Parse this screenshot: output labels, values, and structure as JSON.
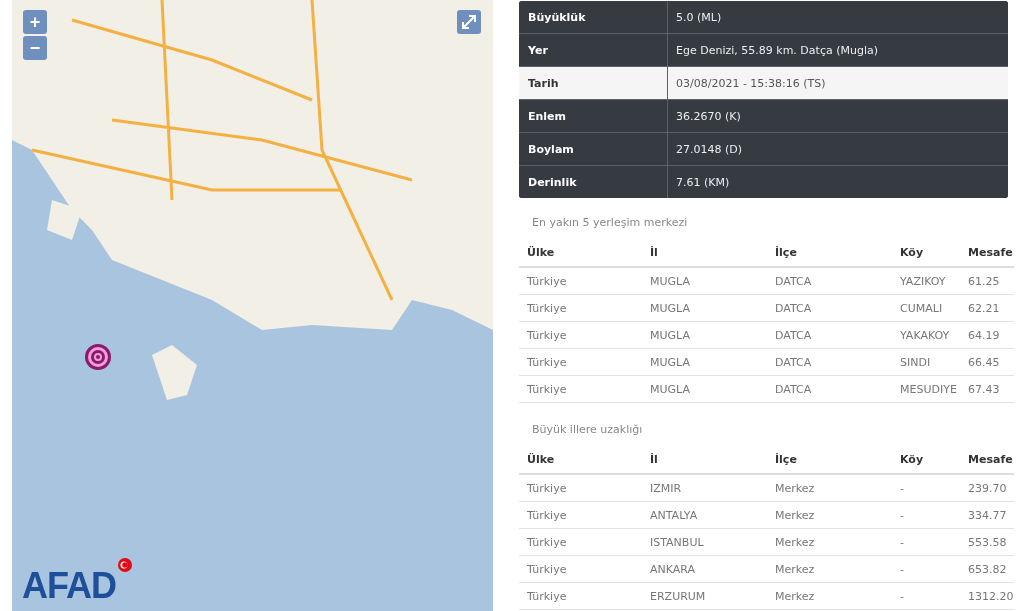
{
  "map": {
    "zoom_in": "+",
    "zoom_out": "−",
    "logo": "AFAD"
  },
  "details": [
    {
      "label": "Büyüklük",
      "value": "5.0 (ML)",
      "highlighted": false
    },
    {
      "label": "Yer",
      "value": "Ege Denizi, 55.89 km. Datça (Mugla)",
      "highlighted": false
    },
    {
      "label": "Tarih",
      "value": "03/08/2021 - 15:38:16 (TS)",
      "highlighted": true
    },
    {
      "label": "Enlem",
      "value": "36.2670 (K)",
      "highlighted": false
    },
    {
      "label": "Boylam",
      "value": "27.0148 (D)",
      "highlighted": false
    },
    {
      "label": "Derinlik",
      "value": "7.61 (KM)",
      "highlighted": false
    }
  ],
  "tables": [
    {
      "title": "En yakın 5 yerleşim merkezi",
      "columns": [
        "Ülke",
        "İl",
        "İlçe",
        "Köy",
        "Mesafe"
      ],
      "rows": [
        [
          "Türkiye",
          "MUGLA",
          "DATCA",
          "YAZIKOY",
          "61.25"
        ],
        [
          "Türkiye",
          "MUGLA",
          "DATCA",
          "CUMALI",
          "62.21"
        ],
        [
          "Türkiye",
          "MUGLA",
          "DATCA",
          "YAKAKOY",
          "64.19"
        ],
        [
          "Türkiye",
          "MUGLA",
          "DATCA",
          "SINDI",
          "66.45"
        ],
        [
          "Türkiye",
          "MUGLA",
          "DATCA",
          "MESUDIYE",
          "67.43"
        ]
      ]
    },
    {
      "title": "Büyük illere uzaklığı",
      "columns": [
        "Ülke",
        "İl",
        "İlçe",
        "Köy",
        "Mesafe"
      ],
      "rows": [
        [
          "Türkiye",
          "IZMIR",
          "Merkez",
          "-",
          "239.70"
        ],
        [
          "Türkiye",
          "ANTALYA",
          "Merkez",
          "-",
          "334.77"
        ],
        [
          "Türkiye",
          "ISTANBUL",
          "Merkez",
          "-",
          "553.58"
        ],
        [
          "Türkiye",
          "ANKARA",
          "Merkez",
          "-",
          "653.82"
        ],
        [
          "Türkiye",
          "ERZURUM",
          "Merkez",
          "-",
          "1312.20"
        ]
      ]
    }
  ]
}
